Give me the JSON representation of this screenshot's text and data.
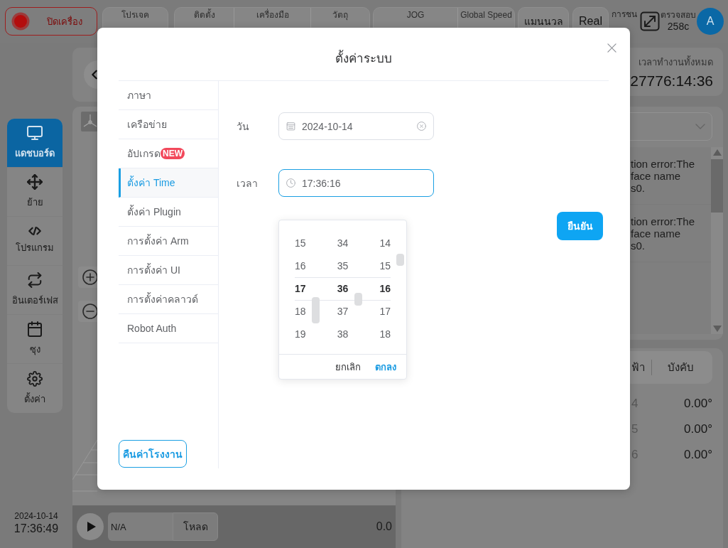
{
  "topbar": {
    "power_button": {
      "label": "ปิดเครื่อง"
    },
    "status_groups": [
      {
        "items": [
          {
            "label": "โปรเจค"
          }
        ]
      },
      {
        "items": [
          {
            "label": "ติดตั้ง"
          },
          {
            "label": "เครื่องมือ"
          },
          {
            "label": "วัตถุ"
          }
        ]
      },
      {
        "items": [
          {
            "label": "JOG"
          },
          {
            "label": "Global Speed"
          }
        ]
      }
    ],
    "mode_button": {
      "label": "แมนนวล"
    },
    "real_button": {
      "label": "Real"
    },
    "collision": {
      "label": "การชน"
    },
    "inspection": {
      "label": "ตรวจสอบ",
      "value": "258c"
    },
    "avatar": {
      "initial": "A"
    }
  },
  "sidebar": {
    "items": [
      {
        "label": "แดชบอร์ด",
        "selected": true
      },
      {
        "label": "ย้าย",
        "selected": false
      },
      {
        "label": "โปรแกรม",
        "selected": false
      },
      {
        "label": "อินเตอร์เฟส",
        "selected": false
      },
      {
        "label": "ซุง",
        "selected": false
      },
      {
        "label": "ตั้งค่า",
        "selected": false
      }
    ],
    "date": "2024-10-14",
    "time": "17:36:49"
  },
  "player": {
    "program": "N/A",
    "load_button": "โหลด",
    "reading": "0.0"
  },
  "runtime": {
    "label": "เวลาทำงานทั้งหมด",
    "value": "27776:14:36"
  },
  "log": {
    "entries": [
      {
        "lines": [
          "tion error:The",
          "face name",
          "s0."
        ]
      },
      {
        "lines": [
          "tion error:The",
          "face name",
          "s0."
        ]
      }
    ]
  },
  "joints": {
    "tabs": [
      {
        "label": "ฟ้า"
      },
      {
        "label": "บังคับ"
      }
    ],
    "rows": [
      {
        "name": "4",
        "value": "0.00°"
      },
      {
        "name": "5",
        "value": "0.00°"
      },
      {
        "name": "6",
        "value": "0.00°"
      }
    ]
  },
  "modal": {
    "title": "ตั้งค่าระบบ",
    "menu": [
      {
        "label": "ภาษา",
        "selected": false
      },
      {
        "label": "เครือข่าย",
        "selected": false
      },
      {
        "label": "อัปเกรด",
        "badge": "NEW",
        "selected": false
      },
      {
        "label": "ตั้งค่า Time",
        "selected": true
      },
      {
        "label": "ตั้งค่า Plugin",
        "selected": false
      },
      {
        "label": "การตั้งค่า Arm",
        "selected": false
      },
      {
        "label": "การตั้งค่า UI",
        "selected": false
      },
      {
        "label": "การตั้งค่าคลาวด์",
        "selected": false
      },
      {
        "label": "Robot Auth",
        "selected": false
      }
    ],
    "reset_button": "คืนค่าโรงงาน",
    "fields": [
      {
        "kind": "date",
        "label": "วัน",
        "value": "2024-10-14",
        "clearable": true,
        "focused": false
      },
      {
        "kind": "time",
        "label": "เวลา",
        "value": "17:36:16",
        "clearable": false,
        "focused": true
      }
    ],
    "confirm_button": "ยืนยัน",
    "time_picker": {
      "columns": [
        {
          "items": [
            {
              "value": "15",
              "selected": false
            },
            {
              "value": "16",
              "selected": false
            },
            {
              "value": "17",
              "selected": true
            },
            {
              "value": "18",
              "selected": false
            },
            {
              "value": "19",
              "selected": false
            }
          ]
        },
        {
          "items": [
            {
              "value": "34",
              "selected": false
            },
            {
              "value": "35",
              "selected": false
            },
            {
              "value": "36",
              "selected": true
            },
            {
              "value": "37",
              "selected": false
            },
            {
              "value": "38",
              "selected": false
            }
          ]
        },
        {
          "items": [
            {
              "value": "14",
              "selected": false
            },
            {
              "value": "15",
              "selected": false
            },
            {
              "value": "16",
              "selected": true
            },
            {
              "value": "17",
              "selected": false
            },
            {
              "value": "18",
              "selected": false
            }
          ]
        }
      ],
      "cancel_button": "ยกเลิก",
      "ok_button": "ตกลง"
    }
  }
}
